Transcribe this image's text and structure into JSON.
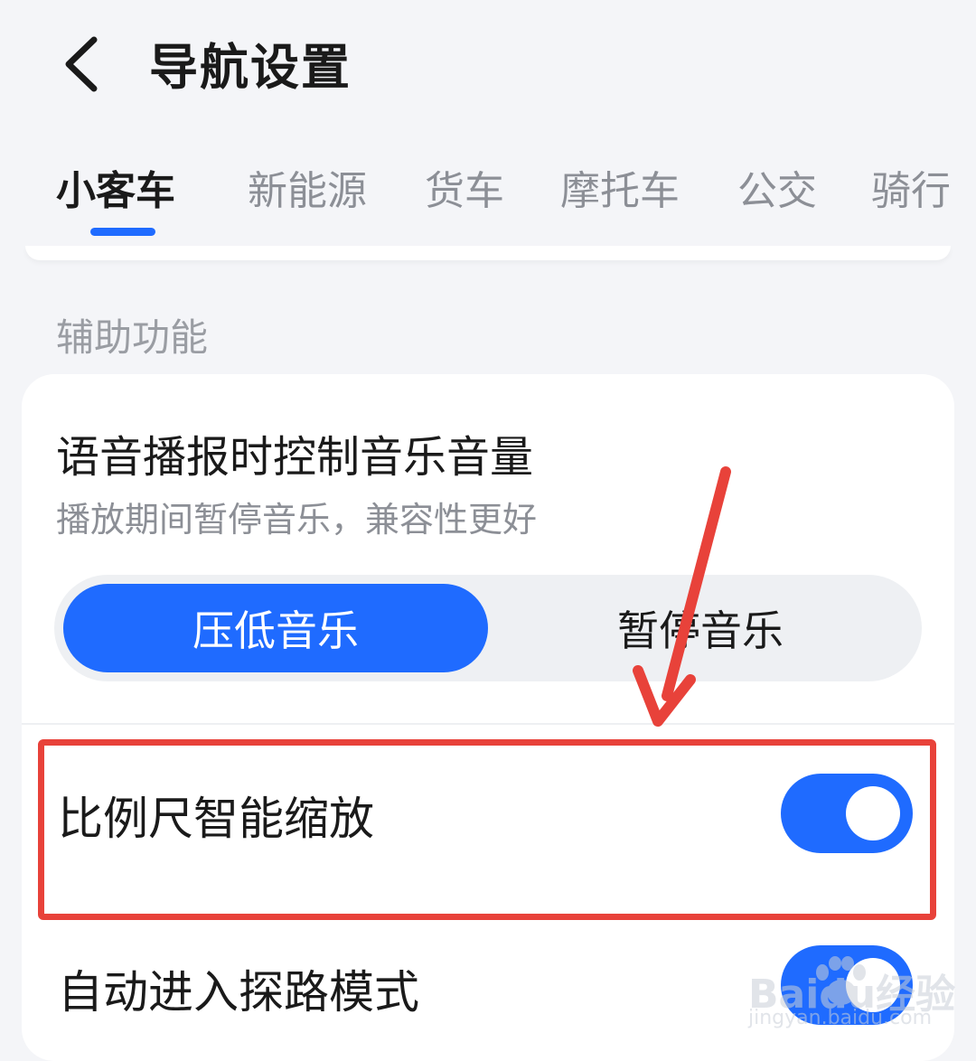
{
  "header": {
    "title": "导航设置",
    "back_icon": "chevron-left-icon"
  },
  "tabs": [
    {
      "label": "小客车",
      "active": true
    },
    {
      "label": "新能源",
      "active": false
    },
    {
      "label": "货车",
      "active": false
    },
    {
      "label": "摩托车",
      "active": false
    },
    {
      "label": "公交",
      "active": false
    },
    {
      "label": "骑行",
      "active": false
    }
  ],
  "section": {
    "label": "辅助功能"
  },
  "voice_setting": {
    "title": "语音播报时控制音乐音量",
    "subtitle": "播放期间暂停音乐，兼容性更好",
    "options": [
      "压低音乐",
      "暂停音乐"
    ],
    "selected": "压低音乐"
  },
  "settings": [
    {
      "label": "比例尺智能缩放",
      "enabled": true
    },
    {
      "label": "自动进入探路模式",
      "enabled": true
    }
  ],
  "watermark": {
    "text": "Baidu经验",
    "url": "jingyan.baidu.com"
  },
  "colors": {
    "accent": "#1f6bff",
    "annotation": "#e8423a",
    "background": "#f4f5f8"
  }
}
